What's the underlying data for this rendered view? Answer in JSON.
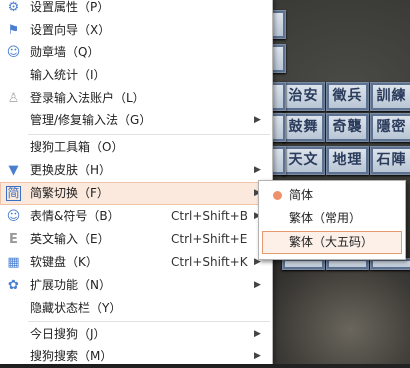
{
  "menu": {
    "items": [
      {
        "icon": "gear-icon",
        "glyph": "⚙",
        "label": "设置属性（P）",
        "shortcut": "",
        "arrow": false
      },
      {
        "icon": "flag-icon",
        "glyph": "⚑",
        "label": "设置向导（X）",
        "shortcut": "",
        "arrow": false
      },
      {
        "icon": "medal-icon",
        "glyph": "☺",
        "label": "勋章墙（Q）",
        "shortcut": "",
        "arrow": false
      },
      {
        "icon": "",
        "glyph": "",
        "label": "输入统计（I）",
        "shortcut": "",
        "arrow": false
      },
      {
        "icon": "user-icon",
        "glyph": "♙",
        "label": "登录输入法账户（L）",
        "shortcut": "",
        "arrow": false
      },
      {
        "icon": "",
        "glyph": "",
        "label": "管理/修复输入法（G）",
        "shortcut": "",
        "arrow": true
      },
      {
        "icon": "",
        "glyph": "",
        "label": "搜狗工具箱（O）",
        "shortcut": "",
        "arrow": false
      },
      {
        "icon": "shirt-icon",
        "glyph": "▼",
        "label": "更换皮肤（H）",
        "shortcut": "",
        "arrow": true
      },
      {
        "icon": "jian-icon",
        "glyph": "简",
        "label": "简繁切换（F）",
        "shortcut": "",
        "arrow": true
      },
      {
        "icon": "smiley-icon",
        "glyph": "☺",
        "label": "表情&符号（B）",
        "shortcut": "Ctrl+Shift+B",
        "arrow": true
      },
      {
        "icon": "english-icon",
        "glyph": "E",
        "label": "英文输入（E）",
        "shortcut": "Ctrl+Shift+E",
        "arrow": false
      },
      {
        "icon": "keyboard-icon",
        "glyph": "▦",
        "label": "软键盘（K）",
        "shortcut": "Ctrl+Shift+K",
        "arrow": true
      },
      {
        "icon": "puzzle-icon",
        "glyph": "✿",
        "label": "扩展功能（N）",
        "shortcut": "",
        "arrow": true
      },
      {
        "icon": "",
        "glyph": "",
        "label": "隐藏状态栏（Y）",
        "shortcut": "",
        "arrow": false
      },
      {
        "icon": "",
        "glyph": "",
        "label": "今日搜狗（J）",
        "shortcut": "",
        "arrow": true
      },
      {
        "icon": "",
        "glyph": "",
        "label": "搜狗搜索（M）",
        "shortcut": "",
        "arrow": true
      }
    ]
  },
  "submenu": {
    "items": [
      {
        "label": "简体",
        "selected": true
      },
      {
        "label": "繁体（常用）",
        "selected": false
      },
      {
        "label": "繁体（大五码）",
        "selected": false
      }
    ]
  },
  "background": {
    "tiles": [
      "治安",
      "徵兵",
      "訓練",
      "鼓舞",
      "奇襲",
      "隱密",
      "天文",
      "地理",
      "石陣"
    ]
  },
  "colors": {
    "highlight": "#fbe9de",
    "radio": "#f0906a",
    "icon": "#4a7fd0"
  }
}
